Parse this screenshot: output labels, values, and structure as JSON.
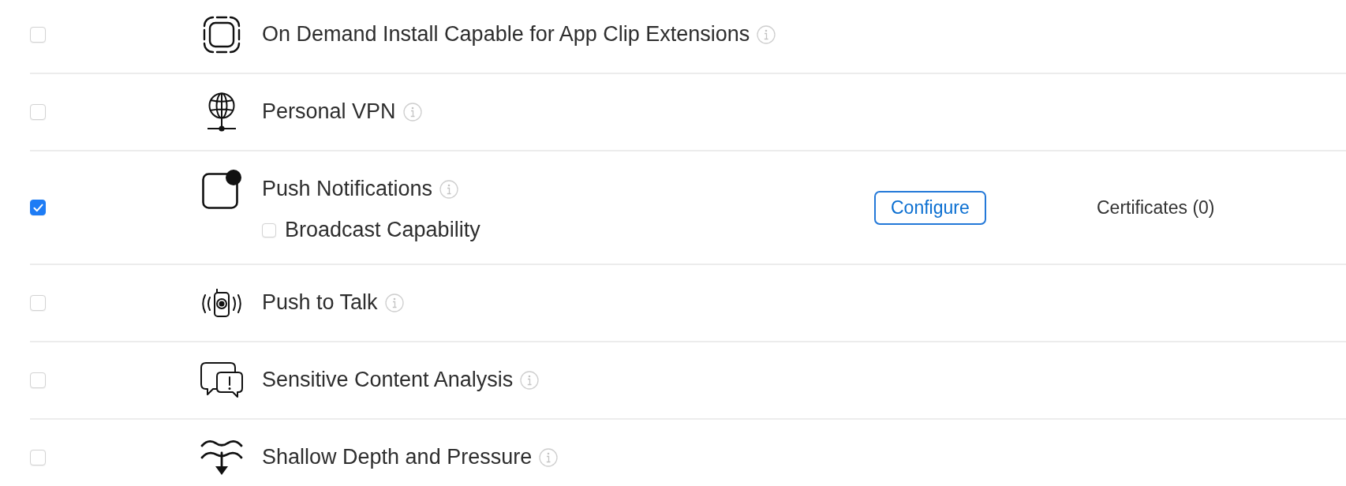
{
  "capabilities": [
    {
      "label": "On Demand Install Capable for App Clip Extensions",
      "checked": false
    },
    {
      "label": "Personal VPN",
      "checked": false
    },
    {
      "label": "Push Notifications",
      "checked": true,
      "options": [
        {
          "label": "Broadcast Capability",
          "checked": false
        }
      ],
      "configure_button": "Configure",
      "certificates": "Certificates (0)"
    },
    {
      "label": "Push to Talk",
      "checked": false
    },
    {
      "label": "Sensitive Content Analysis",
      "checked": false
    },
    {
      "label": "Shallow Depth and Pressure",
      "checked": false
    }
  ]
}
